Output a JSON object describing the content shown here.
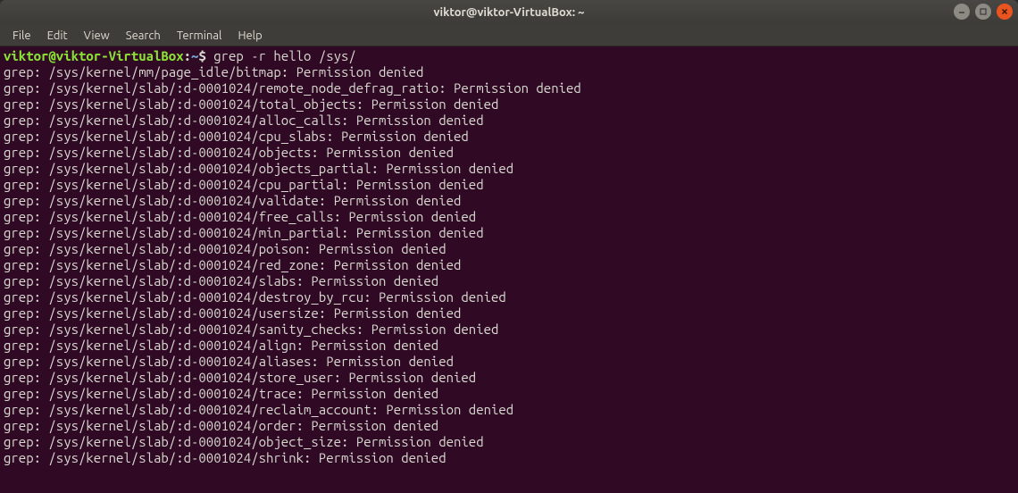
{
  "window": {
    "title": "viktor@viktor-VirtualBox: ~"
  },
  "menubar": {
    "items": [
      {
        "label": "File"
      },
      {
        "label": "Edit"
      },
      {
        "label": "View"
      },
      {
        "label": "Search"
      },
      {
        "label": "Terminal"
      },
      {
        "label": "Help"
      }
    ]
  },
  "prompt": {
    "user_host": "viktor@viktor-VirtualBox",
    "colon": ":",
    "path": "~",
    "dollar": "$"
  },
  "command": "grep -r hello /sys/",
  "output_lines": [
    "grep: /sys/kernel/mm/page_idle/bitmap: Permission denied",
    "grep: /sys/kernel/slab/:d-0001024/remote_node_defrag_ratio: Permission denied",
    "grep: /sys/kernel/slab/:d-0001024/total_objects: Permission denied",
    "grep: /sys/kernel/slab/:d-0001024/alloc_calls: Permission denied",
    "grep: /sys/kernel/slab/:d-0001024/cpu_slabs: Permission denied",
    "grep: /sys/kernel/slab/:d-0001024/objects: Permission denied",
    "grep: /sys/kernel/slab/:d-0001024/objects_partial: Permission denied",
    "grep: /sys/kernel/slab/:d-0001024/cpu_partial: Permission denied",
    "grep: /sys/kernel/slab/:d-0001024/validate: Permission denied",
    "grep: /sys/kernel/slab/:d-0001024/free_calls: Permission denied",
    "grep: /sys/kernel/slab/:d-0001024/min_partial: Permission denied",
    "grep: /sys/kernel/slab/:d-0001024/poison: Permission denied",
    "grep: /sys/kernel/slab/:d-0001024/red_zone: Permission denied",
    "grep: /sys/kernel/slab/:d-0001024/slabs: Permission denied",
    "grep: /sys/kernel/slab/:d-0001024/destroy_by_rcu: Permission denied",
    "grep: /sys/kernel/slab/:d-0001024/usersize: Permission denied",
    "grep: /sys/kernel/slab/:d-0001024/sanity_checks: Permission denied",
    "grep: /sys/kernel/slab/:d-0001024/align: Permission denied",
    "grep: /sys/kernel/slab/:d-0001024/aliases: Permission denied",
    "grep: /sys/kernel/slab/:d-0001024/store_user: Permission denied",
    "grep: /sys/kernel/slab/:d-0001024/trace: Permission denied",
    "grep: /sys/kernel/slab/:d-0001024/reclaim_account: Permission denied",
    "grep: /sys/kernel/slab/:d-0001024/order: Permission denied",
    "grep: /sys/kernel/slab/:d-0001024/object_size: Permission denied",
    "grep: /sys/kernel/slab/:d-0001024/shrink: Permission denied"
  ]
}
